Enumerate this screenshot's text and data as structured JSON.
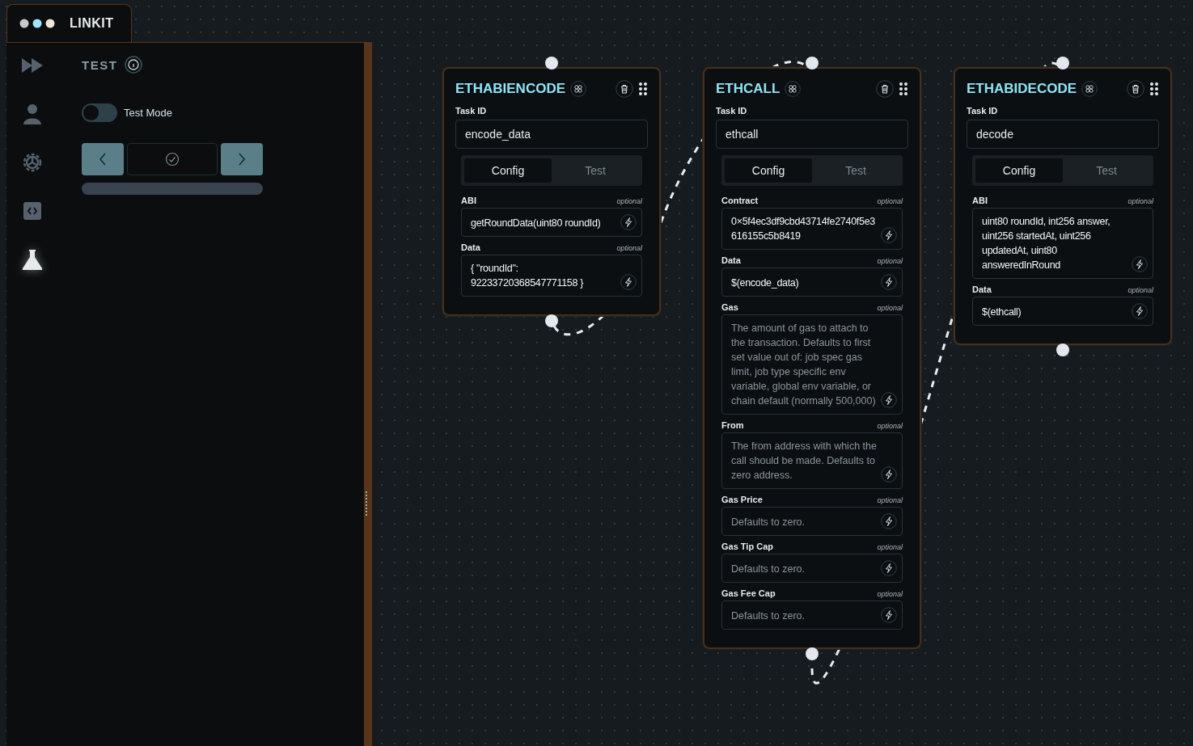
{
  "app": {
    "logo": "LINKIT"
  },
  "sidebar": {
    "items": [
      {
        "kind": "forward",
        "selected": false
      },
      {
        "kind": "user",
        "selected": false
      },
      {
        "kind": "gear",
        "selected": false
      },
      {
        "kind": "code",
        "selected": false
      },
      {
        "kind": "flask",
        "selected": true
      }
    ]
  },
  "panel": {
    "title": "TEST",
    "toggle": {
      "label": "Test Mode",
      "on": false
    }
  },
  "nodes": [
    {
      "title": "ETHABIENCODE",
      "task_id_label": "Task ID",
      "task_id": "encode_data",
      "tabs": [
        {
          "label": "Config",
          "selected": true
        },
        {
          "label": "Test",
          "selected": false
        }
      ],
      "fields": [
        {
          "label": "ABI",
          "note": "optional",
          "value": "getRoundData(uint80 roundId)"
        },
        {
          "label": "Data",
          "note": "optional",
          "value": "{ \"roundId\": 92233720368547771158 }"
        }
      ]
    },
    {
      "title": "ETHCALL",
      "task_id_label": "Task ID",
      "task_id": "ethcall",
      "tabs": [
        {
          "label": "Config",
          "selected": true
        },
        {
          "label": "Test",
          "selected": false
        }
      ],
      "fields": [
        {
          "label": "Contract",
          "note": "optional",
          "value": "0×5f4ec3df9cbd43714fe2740f5e3616155c5b8419"
        },
        {
          "label": "Data",
          "note": "optional",
          "value": "$(encode_data)"
        },
        {
          "label": "Gas",
          "note": "optional",
          "placeholder": "The amount of gas to attach to the transaction. Defaults to first set value out of: job spec gas limit, job type specific env variable, global env variable, or chain default (normally 500,000)"
        },
        {
          "label": "From",
          "note": "optional",
          "placeholder": "The from address with which the call should be made. Defaults to zero address."
        },
        {
          "label": "Gas Price",
          "note": "optional",
          "placeholder": "Defaults to zero."
        },
        {
          "label": "Gas Tip Cap",
          "note": "optional",
          "placeholder": "Defaults to zero."
        },
        {
          "label": "Gas Fee Cap",
          "note": "optional",
          "placeholder": "Defaults to zero."
        }
      ]
    },
    {
      "title": "ETHABIDECODE",
      "task_id_label": "Task ID",
      "task_id": "decode",
      "tabs": [
        {
          "label": "Config",
          "selected": true
        },
        {
          "label": "Test",
          "selected": false
        }
      ],
      "fields": [
        {
          "label": "ABI",
          "note": "optional",
          "value": "uint80 roundId, int256 answer, uint256 startedAt, uint256 updatedAt, uint80 answeredInRound"
        },
        {
          "label": "Data",
          "note": "optional",
          "value": "$(ethcall)"
        }
      ]
    }
  ]
}
